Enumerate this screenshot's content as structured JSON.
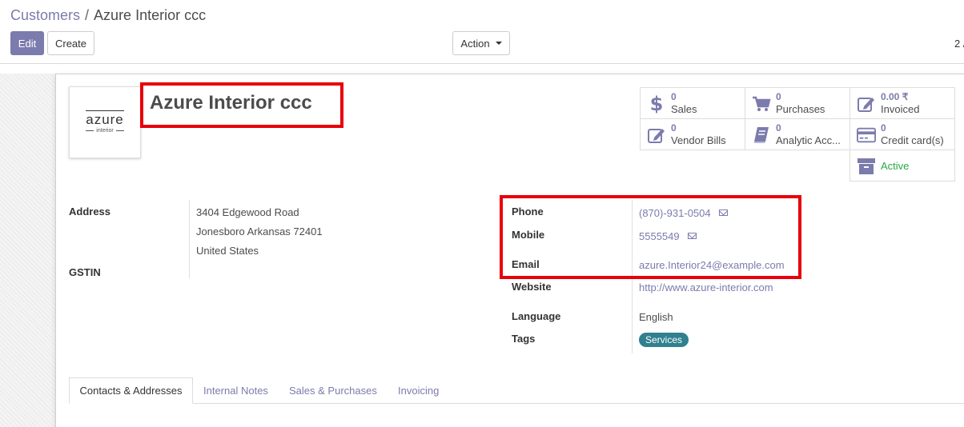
{
  "breadcrumb": {
    "parent": "Customers",
    "separator": "/",
    "current": "Azure Interior ccc"
  },
  "toolbar": {
    "edit_label": "Edit",
    "create_label": "Create",
    "action_label": "Action"
  },
  "pager": {
    "text": "2 /"
  },
  "record": {
    "name": "Azure Interior ccc",
    "logo_text": "azure",
    "logo_subtext": "interior"
  },
  "smart_buttons": {
    "sales": {
      "value": "0",
      "label": "Sales",
      "icon": "dollar-icon"
    },
    "purchases": {
      "value": "0",
      "label": "Purchases",
      "icon": "shopping-cart-icon"
    },
    "invoiced": {
      "value": "0.00 ₹",
      "label": "Invoiced",
      "icon": "pencil-square-icon"
    },
    "vendor_bills": {
      "value": "0",
      "label": "Vendor Bills",
      "icon": "edit-icon"
    },
    "analytic": {
      "value": "0",
      "label": "Analytic Acc...",
      "icon": "book-icon"
    },
    "credit_cards": {
      "value": "0",
      "label": "Credit card(s)",
      "icon": "credit-card-icon"
    },
    "active": {
      "label": "Active",
      "icon": "archive-icon",
      "color": "#28a745"
    }
  },
  "left_fields": {
    "address_label": "Address",
    "address_line1": "3404 Edgewood Road",
    "address_line2": "Jonesboro  Arkansas  72401",
    "address_line3": "United States",
    "gstin_label": "GSTIN"
  },
  "right_fields": {
    "phone_label": "Phone",
    "phone": "(870)-931-0504",
    "mobile_label": "Mobile",
    "mobile": "5555549",
    "email_label": "Email",
    "email": "azure.Interior24@example.com",
    "website_label": "Website",
    "website": "http://www.azure-interior.com",
    "language_label": "Language",
    "language": "English",
    "tags_label": "Tags",
    "tag": "Services"
  },
  "tabs": [
    {
      "label": "Contacts & Addresses",
      "active": true
    },
    {
      "label": "Internal Notes",
      "active": false
    },
    {
      "label": "Sales & Purchases",
      "active": false
    },
    {
      "label": "Invoicing",
      "active": false
    }
  ],
  "colors": {
    "brand": "#7c7bad",
    "highlight": "#e8000b",
    "tag": "#30808f"
  }
}
